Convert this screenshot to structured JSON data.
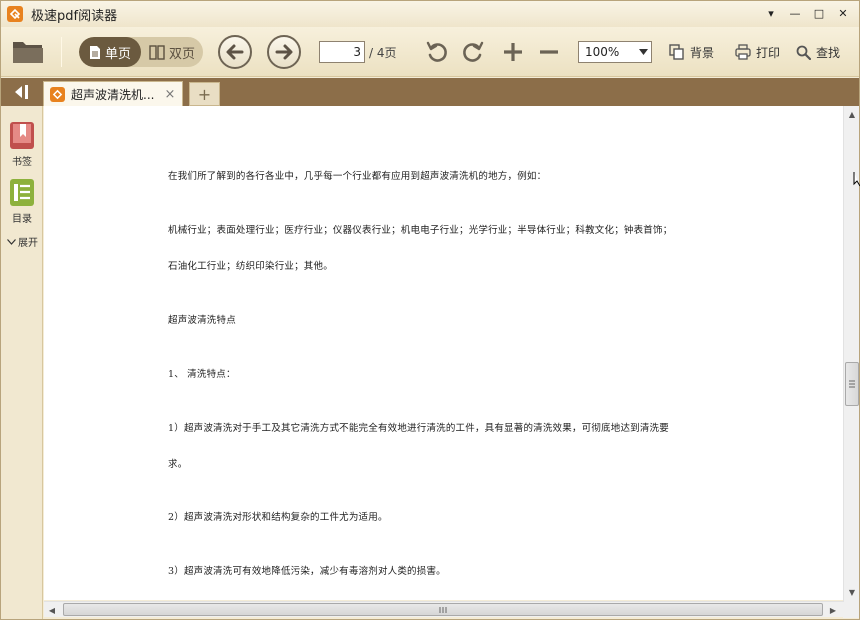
{
  "window": {
    "title": "极速pdf阅读器",
    "controls": {
      "menu": "▾",
      "minimize": "—",
      "maximize": "□",
      "close": "✕"
    }
  },
  "toolbar": {
    "open_icon": "folder-icon",
    "single_page_label": "单页",
    "double_page_label": "双页",
    "current_page": "3",
    "total_pages": "/ 4页",
    "zoom_value": "100%",
    "background_label": "背景",
    "print_label": "打印",
    "find_label": "查找"
  },
  "tabs": {
    "items": [
      {
        "label": "超声波清洗机...",
        "close": "×"
      }
    ],
    "new_tab": "+"
  },
  "sidebar": {
    "bookmark_label": "书签",
    "toc_label": "目录",
    "expand_label": "展开"
  },
  "document": {
    "lines": [
      "在我们所了解到的各行各业中，几乎每一个行业都有应用到超声波清洗机的地方，例如：",
      "机械行业；表面处理行业；医疗行业；仪器仪表行业；机电电子行业；光学行业；半导体行业；科教文化；钟表首饰；",
      "石油化工行业；纺织印染行业；其他。",
      "超声波清洗特点",
      "1、  清洗特点：",
      "1）超声波清洗对于手工及其它清洗方式不能完全有效地进行清洗的工件，具有显著的清洗效果，可彻底地达到清洗要",
      "求。",
      "2）超声波清洗对形状和结构复杂的工件尤为适用。",
      "3）超声波清洗可有效地降低污染，减少有毒溶剂对人类的损害。"
    ]
  },
  "colors": {
    "accent_orange": "#e8821f",
    "toolbar_bg": "#f4ecd6",
    "tabstrip_bg": "#8c6e49",
    "bookmark_red": "#c0504d",
    "toc_green": "#8db13c"
  }
}
